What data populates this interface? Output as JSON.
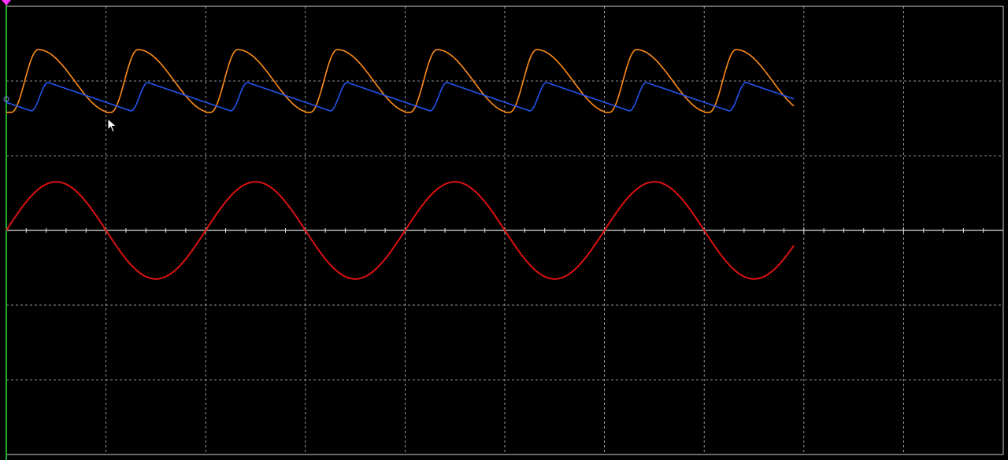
{
  "window": {
    "title": ""
  },
  "screen": {
    "background": "#000000",
    "grid_color": "#bfbfbf",
    "divisions": {
      "horizontal": 10,
      "vertical": 6
    },
    "subdivisions_per_division": 5,
    "grid_style": "dashed"
  },
  "colors": {
    "channel_a_marker": "#22aa33",
    "trigger_marker": "#ff33ff",
    "sine": "#dd1111",
    "orange": "#ff8c1a",
    "blue": "#2255ee",
    "cursor": "#ffffff"
  },
  "icons": {
    "cursor": "mouse-pointer-icon",
    "trigger": "trigger-marker-icon"
  },
  "chart_data": {
    "type": "line",
    "x_range": [
      0,
      10
    ],
    "y_range": [
      -3,
      3
    ],
    "grid": true,
    "traces": [
      {
        "id": "sine",
        "period_div": 2.0,
        "amplitude_div": 0.65,
        "offset_div": 0.0,
        "end_div": 7.9,
        "color_key": "sine"
      },
      {
        "id": "orange",
        "period_div": 1.0,
        "amplitude_div": 0.42,
        "offset_div": 2.0,
        "end_div": 7.9,
        "color_key": "orange"
      },
      {
        "id": "blue",
        "period_div": 1.0,
        "high_div": 1.98,
        "low_div": 1.6,
        "end_div": 7.9,
        "color_key": "blue"
      }
    ]
  }
}
